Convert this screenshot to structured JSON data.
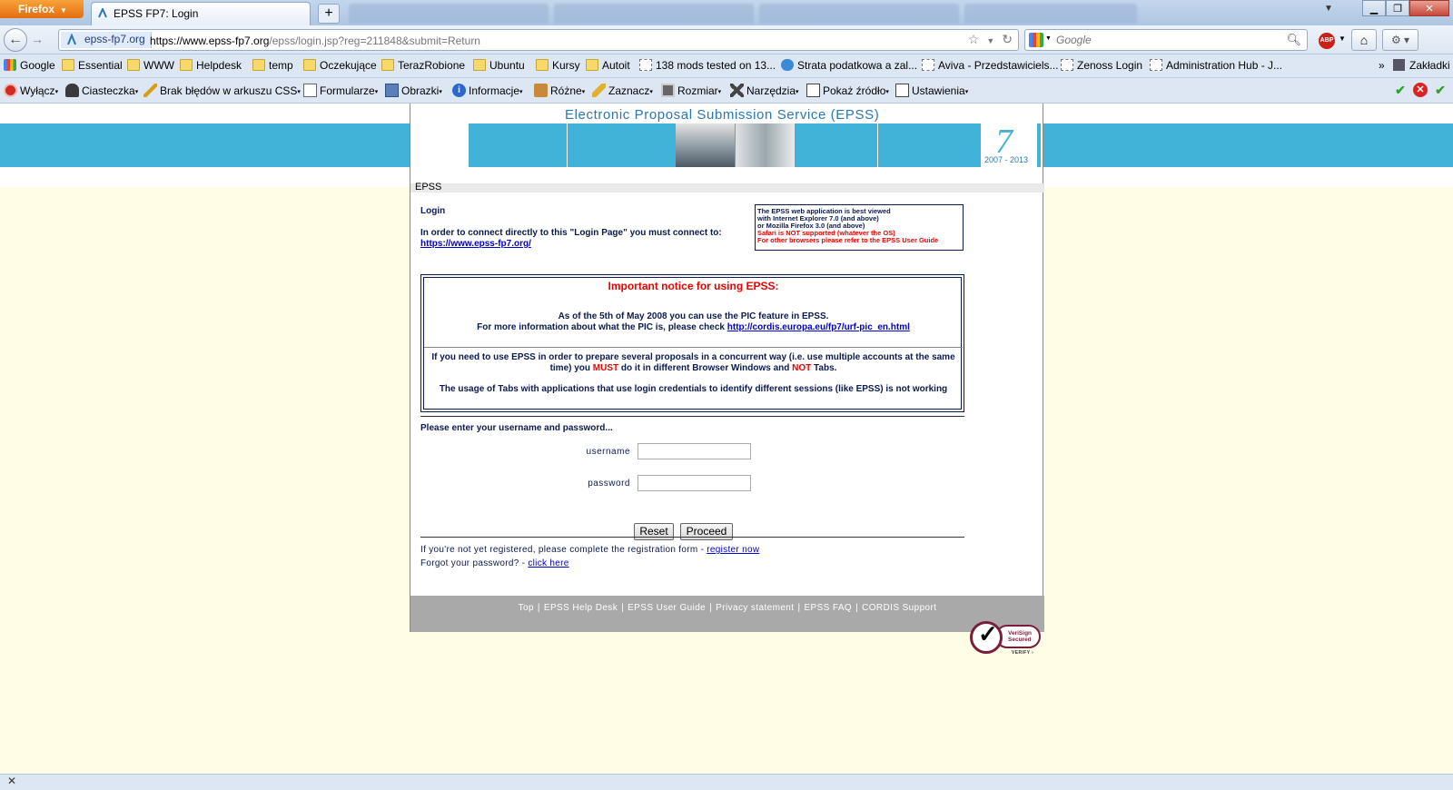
{
  "browser": {
    "menu_button": "Firefox",
    "tab_title": "EPSS FP7: Login",
    "site_identity": "epss-fp7.org",
    "url_host": "https://www.epss-fp7.org",
    "url_path": "/epss/login.jsp?reg=211848&submit=Return",
    "search_placeholder": "Google",
    "bookmarks": [
      "Google",
      "Essential",
      "WWW",
      "Helpdesk",
      "temp",
      "Oczekujące",
      "TerazRobione",
      "Ubuntu",
      "Kursy",
      "Autoit",
      "138 mods tested on 13...",
      "Strata podatkowa a zal...",
      "Aviva - Przedstawiciels...",
      "Zenoss Login",
      "Administration Hub - J..."
    ],
    "bookmarks_menu": "Zakładki",
    "devtoolbar": [
      "Wyłącz",
      "Ciasteczka",
      "Brak błędów w arkuszu CSS",
      "Formularze",
      "Obrazki",
      "Informacje",
      "Różne",
      "Zaznacz",
      "Rozmiar",
      "Narzędzia",
      "Pokaż źródło",
      "Ustawienia"
    ]
  },
  "page": {
    "header_title": "Electronic Proposal Submission Service  (EPSS)",
    "logo_years": "2007 - 2013",
    "crumb": "EPSS",
    "login_heading": "Login",
    "connect_text": "In order to connect directly to this \"Login Page\" you must connect to:",
    "connect_link": "https://www.epss-fp7.org/",
    "browser_note": {
      "line1": "The EPSS web application is best viewed",
      "line2": "with Internet Explorer 7.0 (and above)",
      "line3": "or Mozilla Firefox 3.0 (and above)",
      "line4": "Safari is NOT supported (whatever the OS)",
      "line5": "For other browsers please refer to the EPSS User Guide"
    },
    "notice": {
      "title": "Important notice for using EPSS:",
      "pic_line1": "As of the 5th of May 2008 you can use the PIC feature in EPSS.",
      "pic_line2": "For more information about what the PIC is, please check ",
      "pic_link": "http://cordis.europa.eu/fp7/urf-pic_en.html",
      "tabs_part1": "If you need to use EPSS in order to prepare several proposals in a concurrent way (i.e. use multiple accounts at the same time) you ",
      "tabs_must": "MUST",
      "tabs_part2": " do it in different Browser Windows and ",
      "tabs_not": "NOT",
      "tabs_part3": " Tabs.",
      "sessions": "The usage of Tabs with applications that use login credentials to identify different sessions (like EPSS) is not working"
    },
    "form": {
      "prompt": "Please enter your username and password...",
      "username_label": "username",
      "password_label": "password",
      "username_value": "",
      "password_value": "",
      "reset": "Reset",
      "proceed": "Proceed"
    },
    "register_text": "If you're not yet registered, please complete the registration form - ",
    "register_link": "register now",
    "forgot_text": "Forgot your password? - ",
    "forgot_link": "click here",
    "footer_links": [
      "Top",
      "EPSS Help Desk",
      "EPSS User Guide",
      "Privacy statement",
      "EPSS FAQ",
      "CORDIS Support"
    ],
    "verisign_line1": "VeriSign",
    "verisign_line2": "Secured",
    "verisign_verify": "VERIFY ›"
  },
  "colors": {
    "header_blue": "#41b2d8",
    "notice_red": "#e00000",
    "text_navy": "#0b1a4f",
    "page_background": "#fffde6"
  }
}
